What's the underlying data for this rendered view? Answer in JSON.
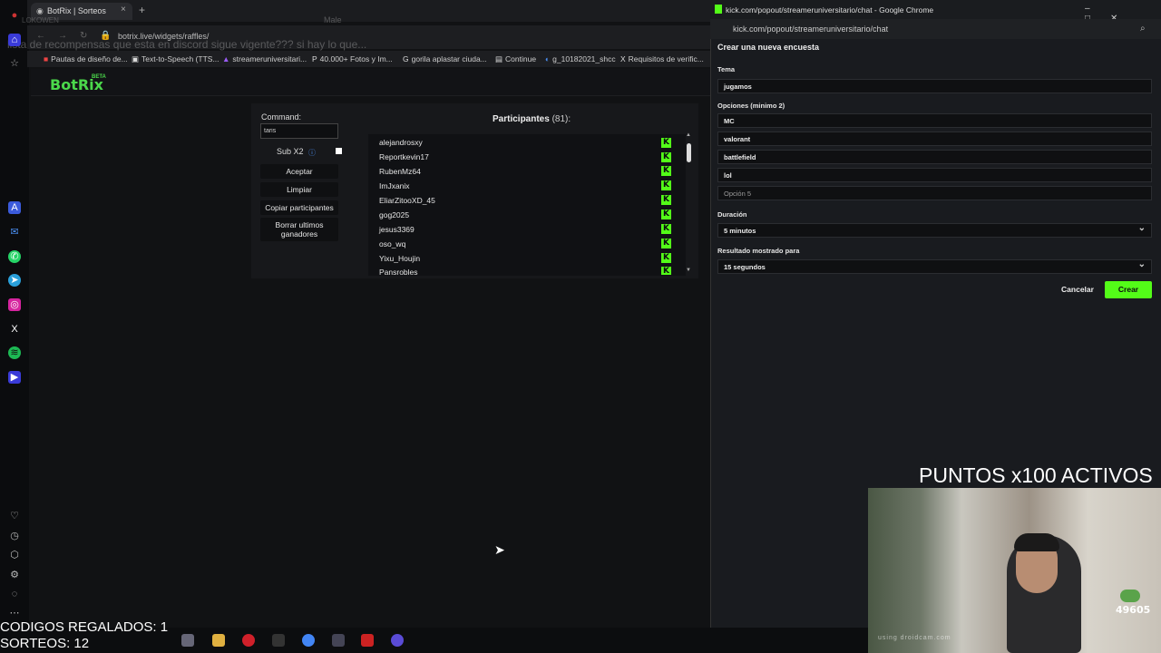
{
  "browser": {
    "tab_title": "BotRix | Sorteos",
    "tab_close": "×",
    "new_tab": "+",
    "url": "botrix.live/widgets/raffles/",
    "bookmarks": [
      "Pautas de diseño de...",
      "Text-to-Speech (TTS...",
      "streameruniversitari...",
      "40.000+ Fotos y Im...",
      "gorila aplastar ciuda...",
      "Continue",
      "g_10182021_shcc",
      "Requisitos de verific..."
    ]
  },
  "ghost": {
    "chat_text": "lista de recompensas que esta en discord sigue vigente??? si hay lo que...",
    "username": "LOKOWEN",
    "male": "Male"
  },
  "botrix": {
    "logo": "BotRix",
    "logo_badge": "BETA",
    "command_label": "Command:",
    "command_value": "taris",
    "sub_label": "Sub X2",
    "sub_info_icon": "ⓘ",
    "buttons": {
      "accept": "Aceptar",
      "clear": "Limpiar",
      "copy": "Copiar participantes",
      "delete_winners": "Borrar ultimos ganadores"
    },
    "participants_title": "Participantes",
    "participants_count": "(81):",
    "participants": [
      "alejandrosxy",
      "Reportkevin17",
      "RubenMz64",
      "ImJxanix",
      "EliarZitooXD_45",
      "gog2025",
      "jesus3369",
      "oso_wq",
      "Yixu_Houjin",
      "Pansrobles"
    ],
    "platform_glyph": "K"
  },
  "kick": {
    "window_title": "kick.com/popout/streameruniversitario/chat - Google Chrome",
    "window_controls": "–□✕",
    "url": "kick.com/popout/streameruniversitario/chat",
    "poll": {
      "heading": "Crear una nueva encuesta",
      "topic_label": "Tema",
      "topic_value": "jugamos",
      "options_label": "Opciones (minimo 2)",
      "options": [
        "MC",
        "valorant",
        "battlefield",
        "lol"
      ],
      "option_placeholder": "Opción 5",
      "duration_label": "Duración",
      "duration_value": "5 minutos",
      "result_label": "Resultado mostrado para",
      "result_value": "15 segundos",
      "cancel": "Cancelar",
      "create": "Crear"
    },
    "accent": "#53fc18"
  },
  "overlay": {
    "banner": "PUNTOS x100 ACTIVOS",
    "counter": "49605",
    "cam_watermark": "using droidcam.com",
    "stats_line1": "CODIGOS REGALADOS: 1",
    "stats_line2": "SORTEOS: 12"
  }
}
